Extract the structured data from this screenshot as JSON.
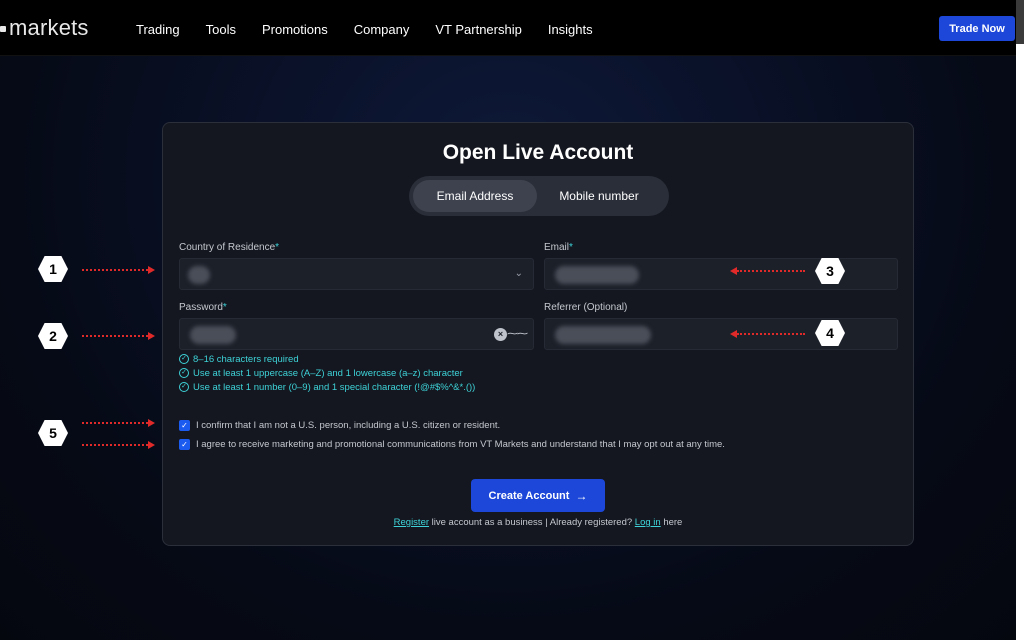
{
  "header": {
    "logo_text": "markets",
    "nav": [
      "Trading",
      "Tools",
      "Promotions",
      "Company",
      "VT Partnership",
      "Insights"
    ],
    "cta": "Trade Now"
  },
  "form": {
    "title": "Open Live Account",
    "tabs": [
      {
        "label": "Email Address",
        "active": true
      },
      {
        "label": "Mobile number",
        "active": false
      }
    ],
    "country_label": "Country of Residence",
    "email_label": "Email",
    "password_label": "Password",
    "referrer_label": "Referrer (Optional)",
    "required_mark": "*",
    "password_rules": [
      "8–16 characters required",
      "Use at least 1 uppercase (A–Z) and 1 lowercase (a–z) character",
      "Use at least 1 number (0–9) and 1 special character (!@#$%^&*.())"
    ],
    "confirm_us": "I confirm that I am not a U.S. person, including a U.S. citizen or resident.",
    "confirm_marketing": "I agree to receive marketing and promotional communications from VT Markets and understand that I may opt out at any time.",
    "submit": "Create Account",
    "footer": {
      "register_link": "Register",
      "middle": " live account as a business | Already registered? ",
      "login_link": "Log in",
      "end": " here"
    }
  },
  "annotations": [
    "1",
    "2",
    "3",
    "4",
    "5"
  ],
  "colors": {
    "accent": "#1c47d8",
    "teal": "#3ed2d8",
    "annotation_arrow": "#e02a2a"
  }
}
